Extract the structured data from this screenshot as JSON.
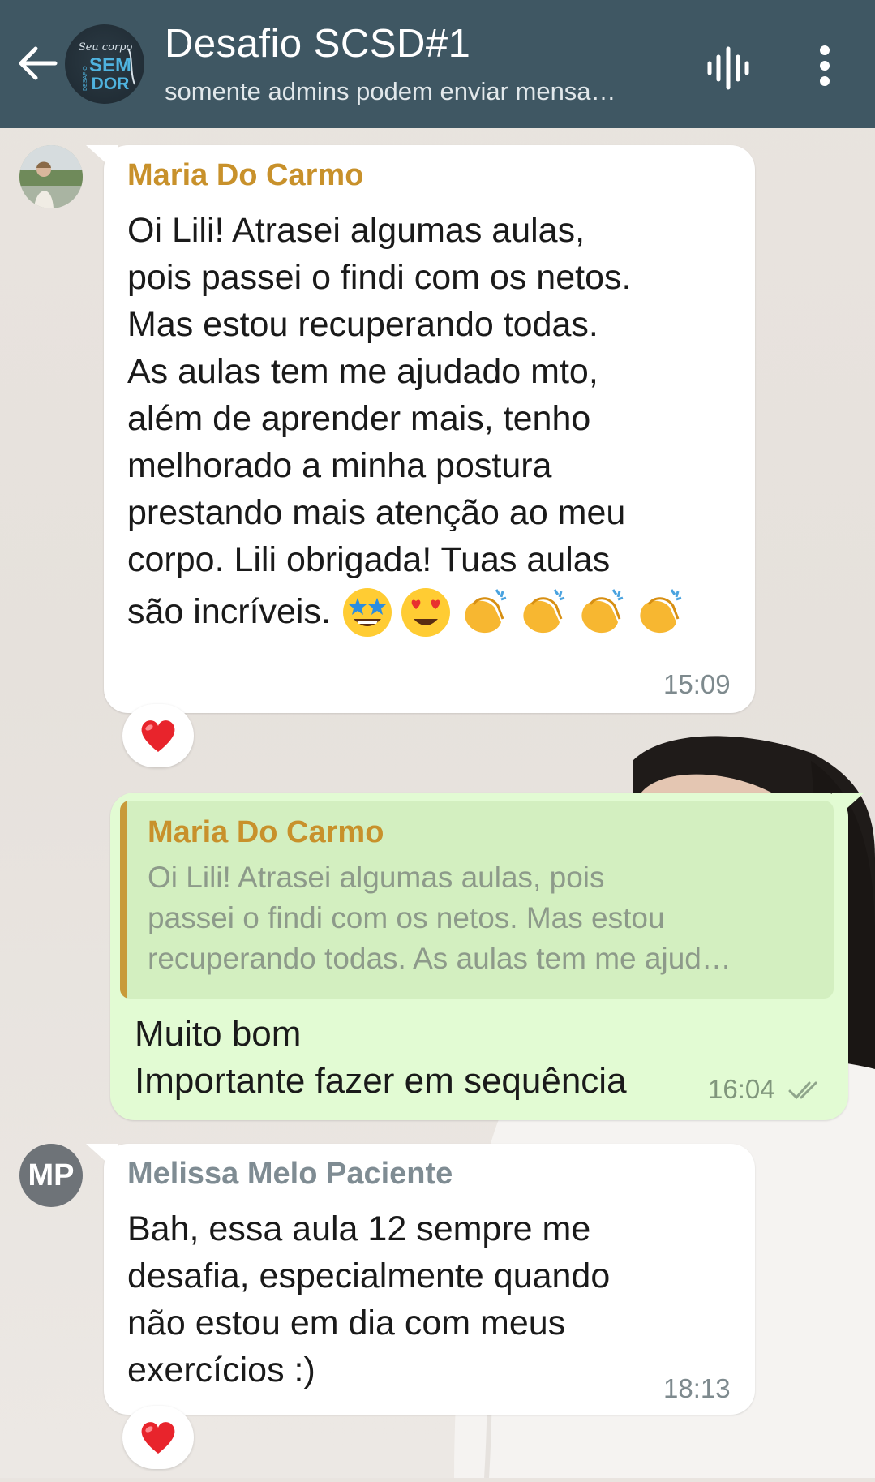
{
  "header": {
    "title": "Desafio SCSD#1",
    "subtitle": "somente admins podem enviar mensa…",
    "avatar_text_top": "Seu corpo",
    "avatar_text_mid": "SEM",
    "avatar_text_bot": "DOR",
    "avatar_text_side": "DESAFIO"
  },
  "messages": [
    {
      "sender": "Maria Do Carmo",
      "text": "Oi Lili! Atrasei algumas aulas,\npois passei o findi com os netos.\nMas estou recuperando todas.\nAs aulas tem me ajudado mto,\nalém de aprender mais, tenho\nmelhorado a minha postura\nprestando mais atenção ao meu\ncorpo. Lili obrigada! Tuas aulas",
      "last_line": "são incríveis.",
      "time": "15:09",
      "reaction": "red-heart"
    },
    {
      "quote_sender": "Maria Do Carmo",
      "quote_text": "Oi Lili! Atrasei algumas aulas, pois\npassei o findi com os netos. Mas estou\nrecuperando todas. As aulas tem me ajud…",
      "text": "Muito bom\nImportante fazer em sequência",
      "time": "16:04",
      "status": "read-double-check"
    },
    {
      "avatar_initials": "MP",
      "sender": "Melissa Melo Paciente",
      "text": "Bah, essa aula 12 sempre me\ndesafia, especialmente quando\nnão estou em dia com meus\nexercícios :)",
      "time": "18:13",
      "reaction": "red-heart"
    }
  ],
  "colors": {
    "header_bg": "#3f5763",
    "sender_maria": "#c8912b",
    "sender_melissa": "#7f8c93",
    "bubble_out": "#e2fbd3",
    "quote_bar": "#c89a3a"
  }
}
